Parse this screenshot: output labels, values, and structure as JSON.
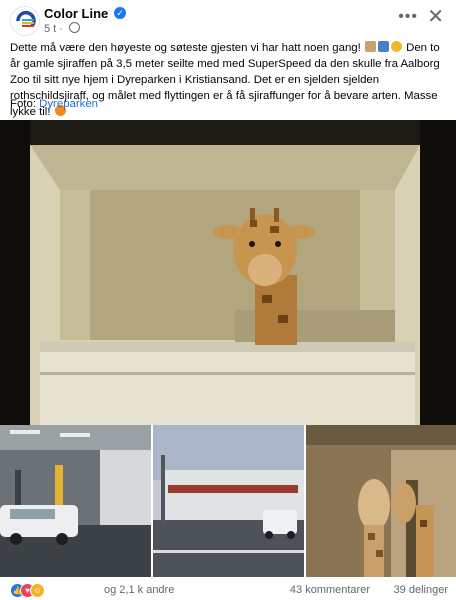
{
  "post": {
    "page_name": "Color Line",
    "time": "5 t",
    "text_line1": "Dette må være den høyeste og søteste gjesten vi har hatt noen gang!",
    "text_rest": "Den to år gamle sjiraffen på 3,5 meter seilte med med SuperSpeed da den skulle fra Aalborg Zoo til sitt nye hjem i Dyreparken i Kristiansand. Det er en sjelden sjelden rothschildsjiraff, og målet med flyttingen er å få sjiraffunger for å bevare arten. Masse lykke til!",
    "credit_prefix": "Foto:",
    "credit_link": "Dyreparken"
  },
  "reactions": {
    "count_text": "og 2,1 k andre",
    "comments": "43 kommentarer",
    "shares": "39 delinger"
  },
  "colors": {
    "link": "#216fdb",
    "muted": "#65676b",
    "brand_verified": "#1877f2"
  },
  "icons": [
    "color-line-logo-icon",
    "verified-badge-icon",
    "globe-icon",
    "more-dots-icon",
    "close-icon",
    "like-reaction-icon",
    "love-reaction-icon",
    "care-reaction-icon"
  ]
}
